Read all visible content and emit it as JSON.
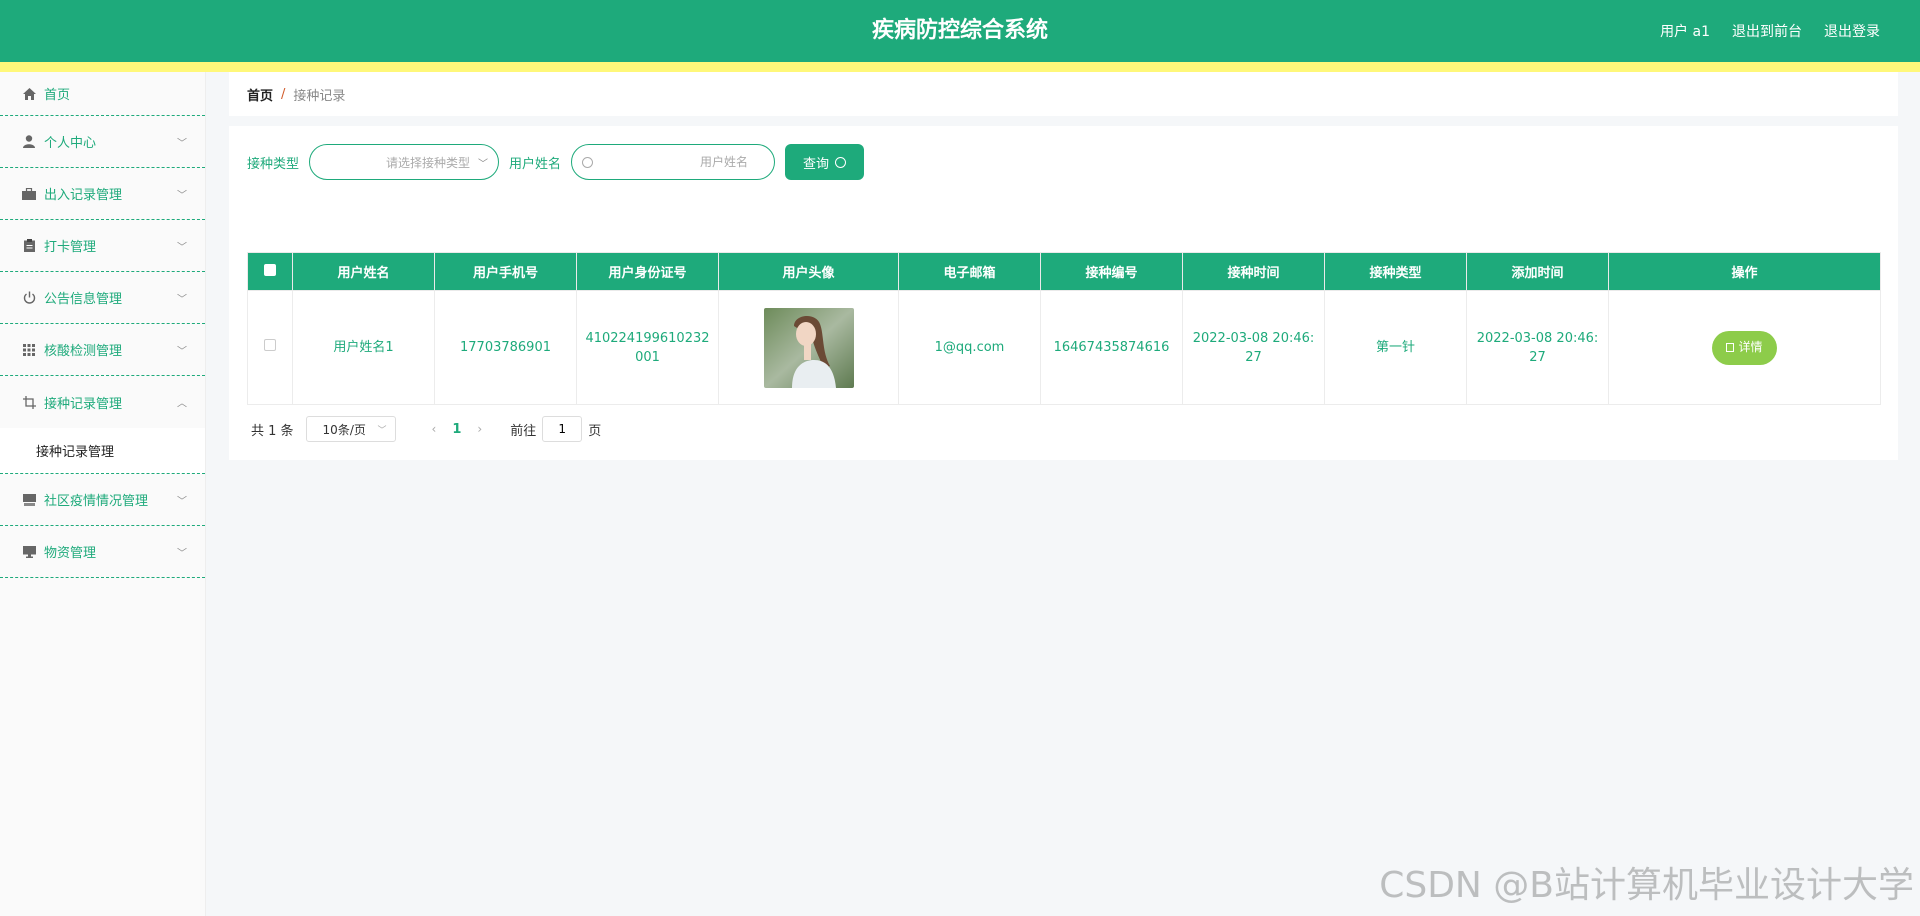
{
  "header": {
    "title": "疾病防控综合系统",
    "user": "用户 a1",
    "back_front": "退出到前台",
    "logout": "退出登录"
  },
  "sidebar": {
    "items": [
      {
        "label": "首页",
        "icon": "home-icon"
      },
      {
        "label": "个人中心",
        "icon": "user-icon"
      },
      {
        "label": "出入记录管理",
        "icon": "briefcase-icon"
      },
      {
        "label": "打卡管理",
        "icon": "clipboard-icon"
      },
      {
        "label": "公告信息管理",
        "icon": "power-icon"
      },
      {
        "label": "核酸检测管理",
        "icon": "grid-icon"
      },
      {
        "label": "接种记录管理",
        "icon": "crop-icon"
      },
      {
        "label": "社区疫情情况管理",
        "icon": "card-icon"
      },
      {
        "label": "物资管理",
        "icon": "monitor-icon"
      }
    ],
    "submenu": "接种记录管理"
  },
  "breadcrumb": {
    "home": "首页",
    "sep": "/",
    "current": "接种记录"
  },
  "search": {
    "type_label": "接种类型",
    "type_placeholder": "请选择接种类型",
    "name_label": "用户姓名",
    "name_placeholder": "用户姓名",
    "query_button": "查询"
  },
  "table": {
    "headers": [
      "用户姓名",
      "用户手机号",
      "用户身份证号",
      "用户头像",
      "电子邮箱",
      "接种编号",
      "接种时间",
      "接种类型",
      "添加时间",
      "操作"
    ],
    "rows": [
      {
        "name": "用户姓名1",
        "phone": "17703786901",
        "id_card": "410224199610232001",
        "email": "1@qq.com",
        "code": "16467435874616",
        "vaccinate_time": "2022-03-08 20:46:27",
        "type": "第一针",
        "add_time": "2022-03-08 20:46:27",
        "detail": "详情"
      }
    ]
  },
  "pager": {
    "total": "共 1 条",
    "page_size": "10条/页",
    "current": "1",
    "goto_label": "前往",
    "goto_value": "1",
    "page_suffix": "页"
  },
  "watermark": "CSDN @B站计算机毕业设计大学"
}
